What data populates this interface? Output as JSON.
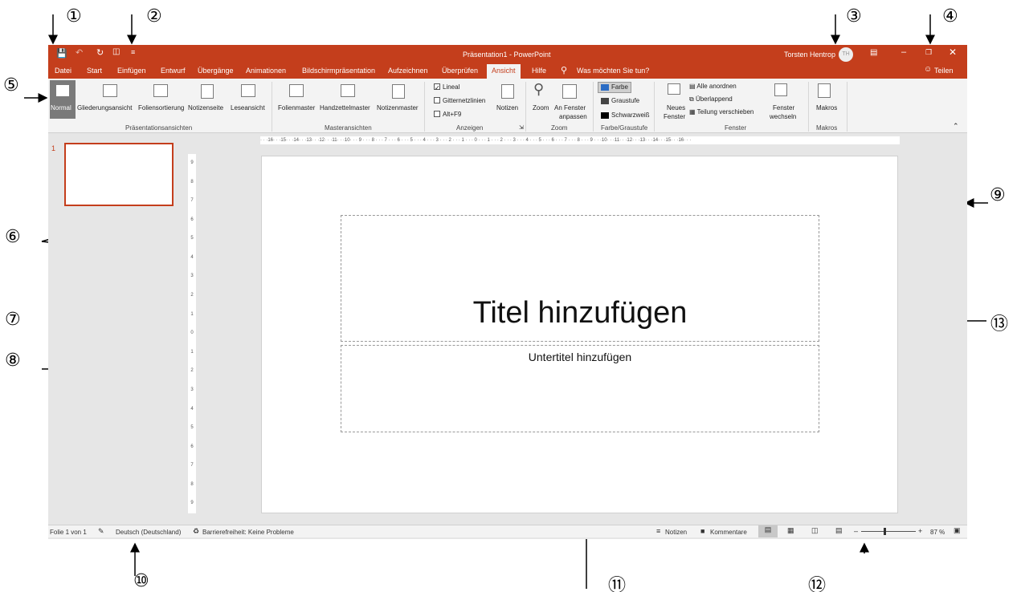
{
  "annotations": [
    "①",
    "②",
    "③",
    "④",
    "⑤",
    "⑥",
    "⑦",
    "⑧",
    "⑨",
    "⑩",
    "⑪",
    "⑫",
    "⑬"
  ],
  "window": {
    "title": "Präsentation1  -  PowerPoint",
    "user": "Torsten Hentrop",
    "user_initials": "TH",
    "accent": "#c43e1c"
  },
  "tabs": [
    "Datei",
    "Start",
    "Einfügen",
    "Entwurf",
    "Übergänge",
    "Animationen",
    "Bildschirmpräsentation",
    "Aufzeichnen",
    "Überprüfen",
    "Ansicht",
    "Hilfe"
  ],
  "tell_me": "Was möchten Sie tun?",
  "share": "Teilen",
  "ribbon": {
    "presentation_views": {
      "label": "Präsentationsansichten",
      "buttons": [
        "Normal",
        "Gliederungsansicht",
        "Foliensortierung",
        "Notizenseite",
        "Leseansicht"
      ]
    },
    "master_views": {
      "label": "Masteransichten",
      "buttons": [
        "Folienmaster",
        "Handzettelmaster",
        "Notizenmaster"
      ]
    },
    "show": {
      "label": "Anzeigen",
      "checks": [
        "Lineal",
        "Gitternetzlinien",
        "Alt+F9"
      ],
      "notes": "Notizen"
    },
    "zoom": {
      "label": "Zoom",
      "zoom": "Zoom",
      "fit_1": "An Fenster",
      "fit_2": "anpassen"
    },
    "color": {
      "label": "Farbe/Graustufe",
      "items": [
        "Farbe",
        "Graustufe",
        "Schwarzweiß"
      ]
    },
    "window_grp": {
      "label": "Fenster",
      "new_1": "Neues",
      "new_2": "Fenster",
      "items": [
        "Alle anordnen",
        "Überlappend",
        "Teilung verschieben"
      ],
      "switch_1": "Fenster",
      "switch_2": "wechseln"
    },
    "macros": {
      "label": "Makros",
      "button": "Makros"
    }
  },
  "slide_number": "1",
  "ruler_h": "· · ·16· · ·15· · ·14· · ·13· · ·12· · ·11· · ·10· · · 9 · · · 8 · · · 7 · · · 6 · · · 5 · · · 4 · · · 3 · · · 2 · · · 1 · · · 0 · · · 1 · · · 2 · · · 3 · · · 4 · · · 5 · · · 6 · · · 7 · · · 8 · · · 9 · · ·10· · ·11· · ·12· · ·13· · ·14· · ·15· · ·16· · ·",
  "ruler_v": [
    "9",
    "8",
    "7",
    "6",
    "5",
    "4",
    "3",
    "2",
    "1",
    "0",
    "1",
    "2",
    "3",
    "4",
    "5",
    "6",
    "7",
    "8",
    "9"
  ],
  "slide": {
    "title": "Titel hinzufügen",
    "subtitle": "Untertitel hinzufügen"
  },
  "status": {
    "slide": "Folie 1 von 1",
    "language": "Deutsch (Deutschland)",
    "accessibility": "Barrierefreiheit: Keine Probleme",
    "notes": "Notizen",
    "comments": "Kommentare",
    "zoom": "87 %"
  }
}
